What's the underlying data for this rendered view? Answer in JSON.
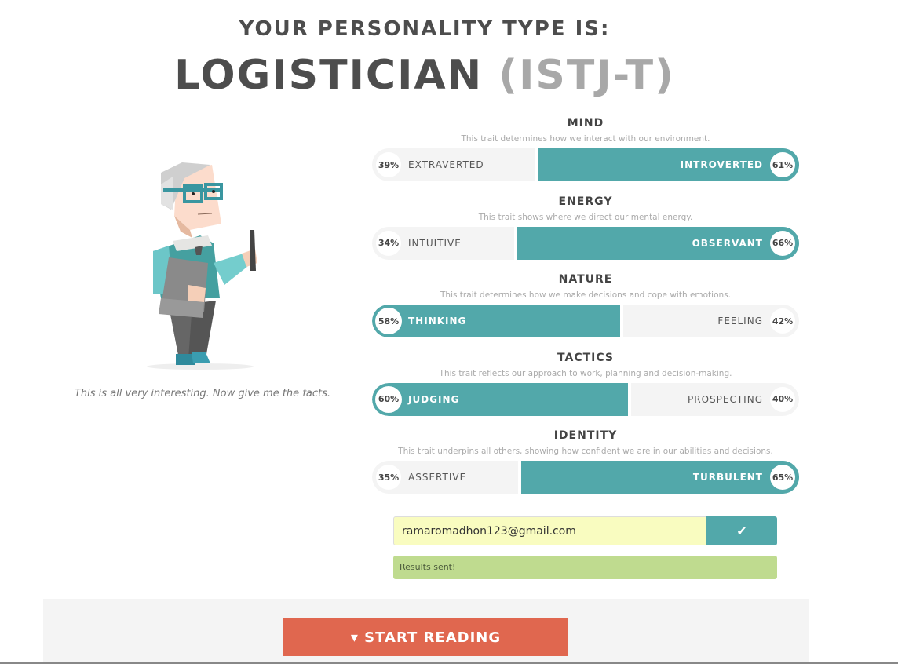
{
  "header": {
    "subtitle": "YOUR PERSONALITY TYPE IS:",
    "type_name": "LOGISTICIAN",
    "type_code": "(ISTJ-T)"
  },
  "caption": "This is all very interesting. Now give me the facts.",
  "traits": [
    {
      "title": "MIND",
      "desc": "This trait determines how we interact with our environment.",
      "left_label": "EXTRAVERTED",
      "left_pct": "39%",
      "right_label": "INTROVERTED",
      "right_pct": "61%",
      "winner": "right",
      "value": 61
    },
    {
      "title": "ENERGY",
      "desc": "This trait shows where we direct our mental energy.",
      "left_label": "INTUITIVE",
      "left_pct": "34%",
      "right_label": "OBSERVANT",
      "right_pct": "66%",
      "winner": "right",
      "value": 66
    },
    {
      "title": "NATURE",
      "desc": "This trait determines how we make decisions and cope with emotions.",
      "left_label": "THINKING",
      "left_pct": "58%",
      "right_label": "FEELING",
      "right_pct": "42%",
      "winner": "left",
      "value": 58
    },
    {
      "title": "TACTICS",
      "desc": "This trait reflects our approach to work, planning and decision-making.",
      "left_label": "JUDGING",
      "left_pct": "60%",
      "right_label": "PROSPECTING",
      "right_pct": "40%",
      "winner": "left",
      "value": 60
    },
    {
      "title": "IDENTITY",
      "desc": "This trait underpins all others, showing how confident we are in our abilities and decisions.",
      "left_label": "ASSERTIVE",
      "left_pct": "35%",
      "right_label": "TURBULENT",
      "right_pct": "65%",
      "winner": "right",
      "value": 65
    }
  ],
  "email": {
    "value": "ramaromadhon123@gmail.com",
    "submit_icon": "check-icon",
    "submit_glyph": "✔"
  },
  "status": "Results sent!",
  "cta": {
    "label": "▾ START READING"
  },
  "colors": {
    "accent": "#52a8aa",
    "cta": "#e0674f",
    "success": "#bfdb8f"
  }
}
